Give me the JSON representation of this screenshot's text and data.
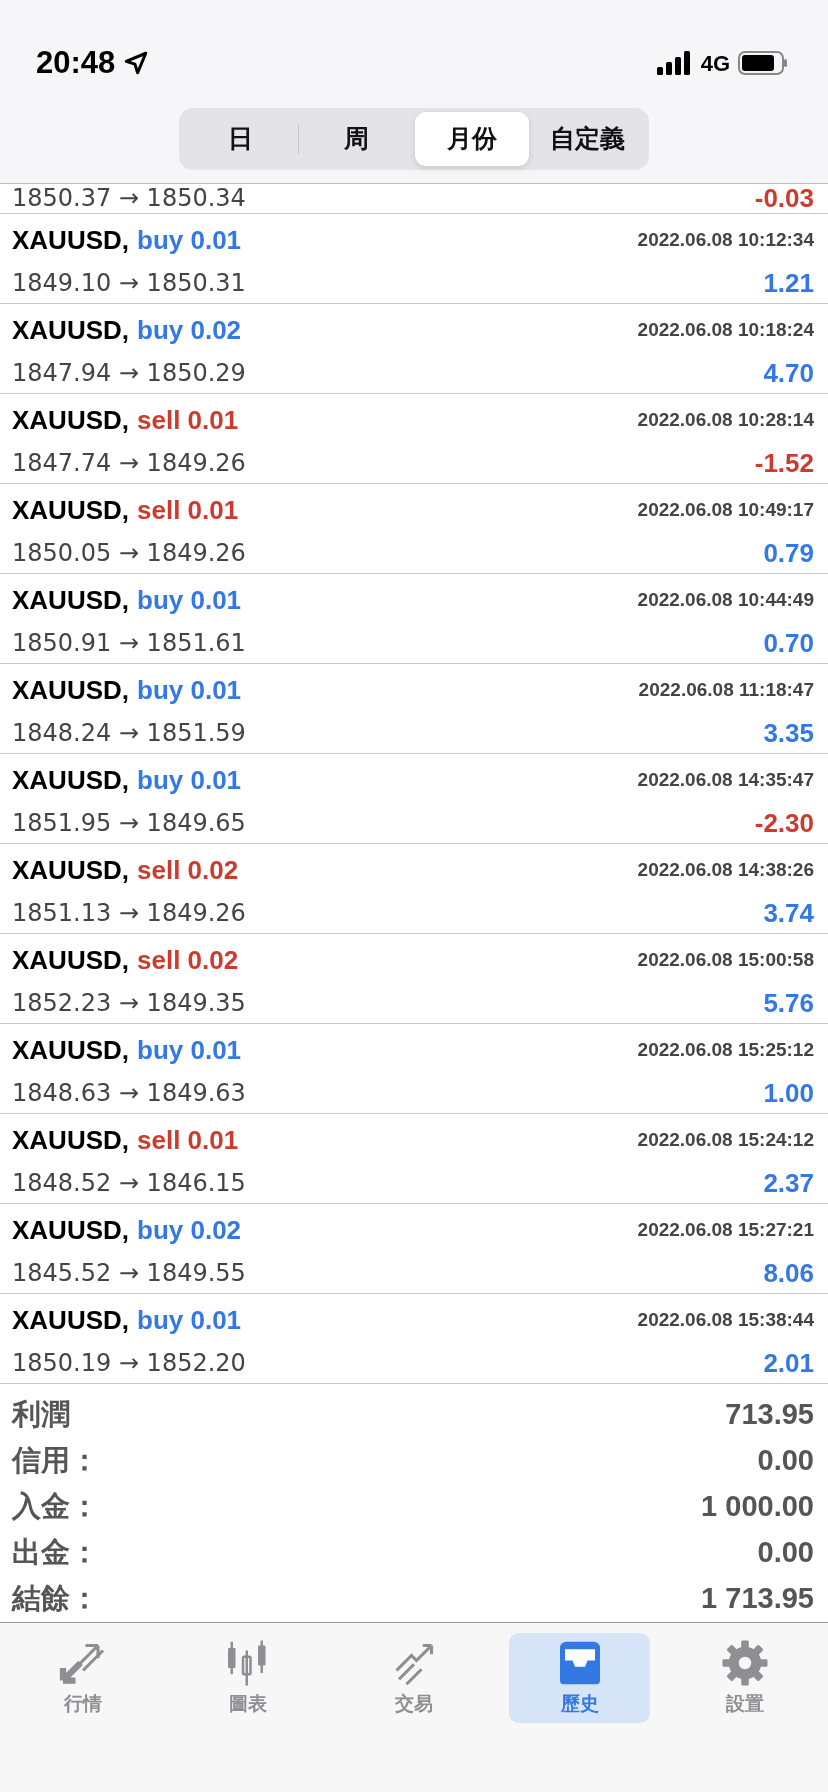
{
  "status_bar": {
    "time": "20:48",
    "network": "4G"
  },
  "period_tabs": [
    {
      "label": "日",
      "selected": false
    },
    {
      "label": "周",
      "selected": false
    },
    {
      "label": "月份",
      "selected": true
    },
    {
      "label": "自定義",
      "selected": false
    }
  ],
  "partial_row": {
    "prices": "1850.37 → 1850.34",
    "profit": "-0.03",
    "loss": true
  },
  "deals": [
    {
      "symbol": "XAUUSD,",
      "type": "buy",
      "volume": "0.01",
      "time": "2022.06.08 10:12:34",
      "prices": "1849.10 → 1850.31",
      "profit": "1.21",
      "loss": false
    },
    {
      "symbol": "XAUUSD,",
      "type": "buy",
      "volume": "0.02",
      "time": "2022.06.08 10:18:24",
      "prices": "1847.94 → 1850.29",
      "profit": "4.70",
      "loss": false
    },
    {
      "symbol": "XAUUSD,",
      "type": "sell",
      "volume": "0.01",
      "time": "2022.06.08 10:28:14",
      "prices": "1847.74 → 1849.26",
      "profit": "-1.52",
      "loss": true
    },
    {
      "symbol": "XAUUSD,",
      "type": "sell",
      "volume": "0.01",
      "time": "2022.06.08 10:49:17",
      "prices": "1850.05 → 1849.26",
      "profit": "0.79",
      "loss": false
    },
    {
      "symbol": "XAUUSD,",
      "type": "buy",
      "volume": "0.01",
      "time": "2022.06.08 10:44:49",
      "prices": "1850.91 → 1851.61",
      "profit": "0.70",
      "loss": false
    },
    {
      "symbol": "XAUUSD,",
      "type": "buy",
      "volume": "0.01",
      "time": "2022.06.08 11:18:47",
      "prices": "1848.24 → 1851.59",
      "profit": "3.35",
      "loss": false
    },
    {
      "symbol": "XAUUSD,",
      "type": "buy",
      "volume": "0.01",
      "time": "2022.06.08 14:35:47",
      "prices": "1851.95 → 1849.65",
      "profit": "-2.30",
      "loss": true
    },
    {
      "symbol": "XAUUSD,",
      "type": "sell",
      "volume": "0.02",
      "time": "2022.06.08 14:38:26",
      "prices": "1851.13 → 1849.26",
      "profit": "3.74",
      "loss": false
    },
    {
      "symbol": "XAUUSD,",
      "type": "sell",
      "volume": "0.02",
      "time": "2022.06.08 15:00:58",
      "prices": "1852.23 → 1849.35",
      "profit": "5.76",
      "loss": false
    },
    {
      "symbol": "XAUUSD,",
      "type": "buy",
      "volume": "0.01",
      "time": "2022.06.08 15:25:12",
      "prices": "1848.63 → 1849.63",
      "profit": "1.00",
      "loss": false
    },
    {
      "symbol": "XAUUSD,",
      "type": "sell",
      "volume": "0.01",
      "time": "2022.06.08 15:24:12",
      "prices": "1848.52 → 1846.15",
      "profit": "2.37",
      "loss": false
    },
    {
      "symbol": "XAUUSD,",
      "type": "buy",
      "volume": "0.02",
      "time": "2022.06.08 15:27:21",
      "prices": "1845.52 → 1849.55",
      "profit": "8.06",
      "loss": false
    },
    {
      "symbol": "XAUUSD,",
      "type": "buy",
      "volume": "0.01",
      "time": "2022.06.08 15:38:44",
      "prices": "1850.19 → 1852.20",
      "profit": "2.01",
      "loss": false
    }
  ],
  "summary": [
    {
      "label": "利潤",
      "value": "713.95"
    },
    {
      "label": "信用：",
      "value": "0.00"
    },
    {
      "label": "入金：",
      "value": "1 000.00"
    },
    {
      "label": "出金：",
      "value": "0.00"
    },
    {
      "label": "結餘：",
      "value": "1 713.95"
    }
  ],
  "tab_bar": [
    {
      "kind": "quotes",
      "label": "行情",
      "selected": false
    },
    {
      "kind": "chart",
      "label": "圖表",
      "selected": false
    },
    {
      "kind": "trade",
      "label": "交易",
      "selected": false
    },
    {
      "kind": "history",
      "label": "歷史",
      "selected": true
    },
    {
      "kind": "settings",
      "label": "設置",
      "selected": false
    }
  ]
}
